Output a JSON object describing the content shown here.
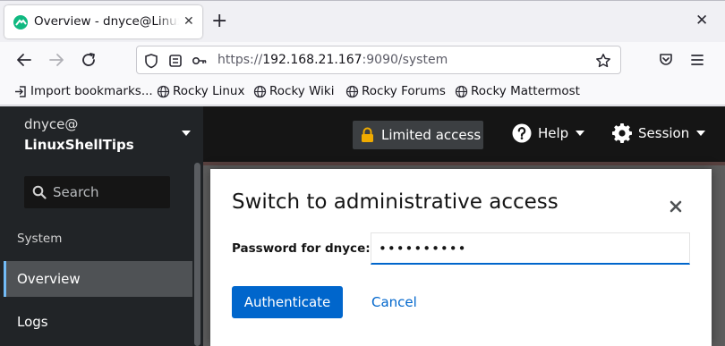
{
  "browser": {
    "tab_title": "Overview - dnyce@LinuxShellTips",
    "url_prefix": "https://",
    "url_host": "192.168.21.167",
    "url_rest": ":9090/system",
    "bookmarks": [
      {
        "label": "Import bookmarks...",
        "icon": "import-icon"
      },
      {
        "label": "Rocky Linux",
        "icon": "globe-icon"
      },
      {
        "label": "Rocky Wiki",
        "icon": "globe-icon"
      },
      {
        "label": "Rocky Forums",
        "icon": "globe-icon"
      },
      {
        "label": "Rocky Mattermost",
        "icon": "globe-icon"
      }
    ]
  },
  "cockpit": {
    "host_user": "dnyce@",
    "host_name": "LinuxShellTips",
    "search_placeholder": "Search",
    "section_heading": "System",
    "nav": [
      {
        "label": "Overview",
        "active": true
      },
      {
        "label": "Logs",
        "active": false
      }
    ],
    "limited_access": "Limited access",
    "help": "Help",
    "session": "Session"
  },
  "modal": {
    "title": "Switch to administrative access",
    "password_label": "Password for dnyce:",
    "password_value": "••••••••••",
    "authenticate": "Authenticate",
    "cancel": "Cancel"
  },
  "colors": {
    "primary": "#0066cc",
    "sidebar_bg": "#212427",
    "masthead_bg": "#151515",
    "active_border": "#73bcf7",
    "lock": "#f0ab00"
  }
}
